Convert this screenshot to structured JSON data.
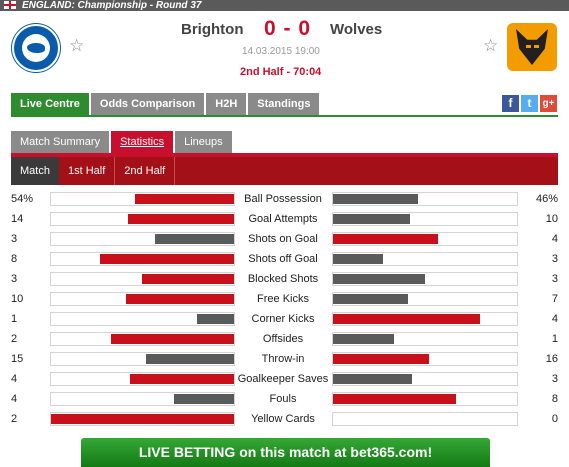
{
  "header": {
    "competition": "ENGLAND: Championship - Round 37"
  },
  "match": {
    "home_team": "Brighton",
    "away_team": "Wolves",
    "score": "0 - 0",
    "date": "14.03.2015 19:00",
    "status": "2nd Half - 70:04"
  },
  "main_tabs": [
    "Live Centre",
    "Odds Comparison",
    "H2H",
    "Standings"
  ],
  "sub_tabs": [
    "Match Summary",
    "Statistics",
    "Lineups"
  ],
  "period_tabs": [
    "Match",
    "1st Half",
    "2nd Half"
  ],
  "social": {
    "facebook": "f",
    "twitter": "t",
    "googleplus": "g+"
  },
  "colors": {
    "accent_green": "#2e8b2e",
    "accent_red": "#c8102e",
    "bar_leader": "#c8101a",
    "bar_trailer": "#5a5a5a"
  },
  "stats": [
    {
      "label": "Ball Possession",
      "home": "54%",
      "away": "46%",
      "home_frac": 0.54,
      "away_frac": 0.46
    },
    {
      "label": "Goal Attempts",
      "home": "14",
      "away": "10",
      "home_frac": 0.58,
      "away_frac": 0.42
    },
    {
      "label": "Shots on Goal",
      "home": "3",
      "away": "4",
      "home_frac": 0.43,
      "away_frac": 0.57
    },
    {
      "label": "Shots off Goal",
      "home": "8",
      "away": "3",
      "home_frac": 0.73,
      "away_frac": 0.27
    },
    {
      "label": "Blocked Shots",
      "home": "3",
      "away": "3",
      "home_frac": 0.5,
      "away_frac": 0.5
    },
    {
      "label": "Free Kicks",
      "home": "10",
      "away": "7",
      "home_frac": 0.59,
      "away_frac": 0.41
    },
    {
      "label": "Corner Kicks",
      "home": "1",
      "away": "4",
      "home_frac": 0.2,
      "away_frac": 0.8
    },
    {
      "label": "Offsides",
      "home": "2",
      "away": "1",
      "home_frac": 0.67,
      "away_frac": 0.33
    },
    {
      "label": "Throw-in",
      "home": "15",
      "away": "16",
      "home_frac": 0.48,
      "away_frac": 0.52
    },
    {
      "label": "Goalkeeper Saves",
      "home": "4",
      "away": "3",
      "home_frac": 0.57,
      "away_frac": 0.43
    },
    {
      "label": "Fouls",
      "home": "4",
      "away": "8",
      "home_frac": 0.33,
      "away_frac": 0.67
    },
    {
      "label": "Yellow Cards",
      "home": "2",
      "away": "0",
      "home_frac": 1.0,
      "away_frac": 0.0
    }
  ],
  "promo": {
    "text": "LIVE BETTING on this match at bet365.com!"
  }
}
